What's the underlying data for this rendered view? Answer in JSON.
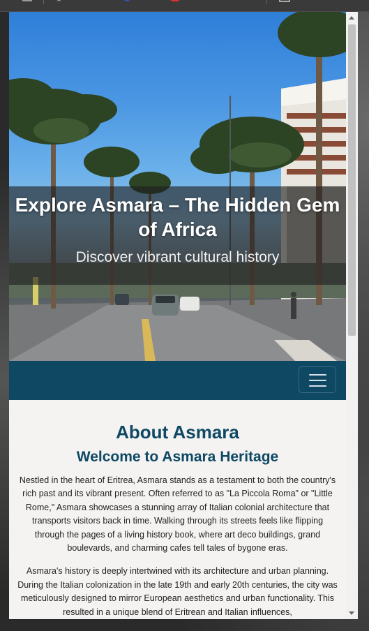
{
  "hero": {
    "title": "Explore Asmara – The Hidden Gem of Africa",
    "subtitle": "Discover vibrant cultural history"
  },
  "navbar": {
    "toggle_icon": "hamburger-icon",
    "background": "#0e4863"
  },
  "about": {
    "heading": "About Asmara",
    "subheading": "Welcome to Asmara Heritage",
    "paragraphs": [
      "Nestled in the heart of Eritrea, Asmara stands as a testament to both the country's rich past and its vibrant present. Often referred to as \"La Piccola Roma\" or \"Little Rome,\" Asmara showcases a stunning array of Italian colonial architecture that transports visitors back in time. Walking through its streets feels like flipping through the pages of a living history book, where art deco buildings, grand boulevards, and charming cafes tell tales of bygone eras.",
      "Asmara's history is deeply intertwined with its architecture and urban planning. During the Italian colonization in the late 19th and early 20th centuries, the city was meticulously designed to mirror European aesthetics and urban functionality. This resulted in a unique blend of Eritrean and Italian influences,"
    ]
  },
  "colors": {
    "accent": "#0e4863",
    "page_background": "#f4f3f2"
  }
}
